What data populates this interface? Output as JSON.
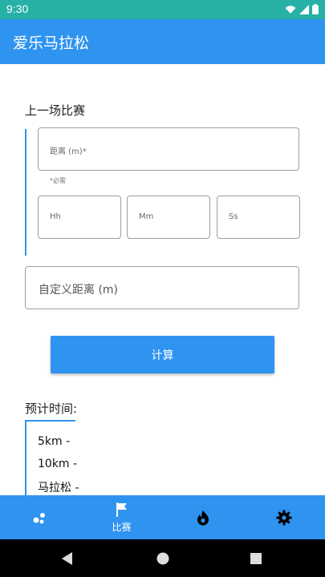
{
  "status_bar": {
    "time": "9:30",
    "icons": [
      "wifi-icon",
      "signal-icon",
      "battery-icon"
    ]
  },
  "app_bar": {
    "title": "爱乐马拉松"
  },
  "last_race": {
    "heading": "上一场比赛",
    "distance_placeholder": "距离 (m)*",
    "distance_helper": "*必需",
    "hours_placeholder": "Hh",
    "minutes_placeholder": "Mm",
    "seconds_placeholder": "Ss"
  },
  "custom_distance_placeholder": "自定义距离 (m)",
  "calculate_label": "计算",
  "results": {
    "heading": "预计时间:",
    "items": [
      "5km -",
      "10km -",
      "马拉松 -"
    ]
  },
  "bottom_nav": {
    "items": [
      {
        "icon": "dots-icon",
        "label": ""
      },
      {
        "icon": "flag-icon",
        "label": "比赛"
      },
      {
        "icon": "flame-icon",
        "label": ""
      },
      {
        "icon": "gear-icon",
        "label": ""
      }
    ],
    "selected": "比赛"
  },
  "colors": {
    "primary": "#2f93f0",
    "status_bar": "#26b0a6",
    "field_border": "#9e9e9e"
  }
}
